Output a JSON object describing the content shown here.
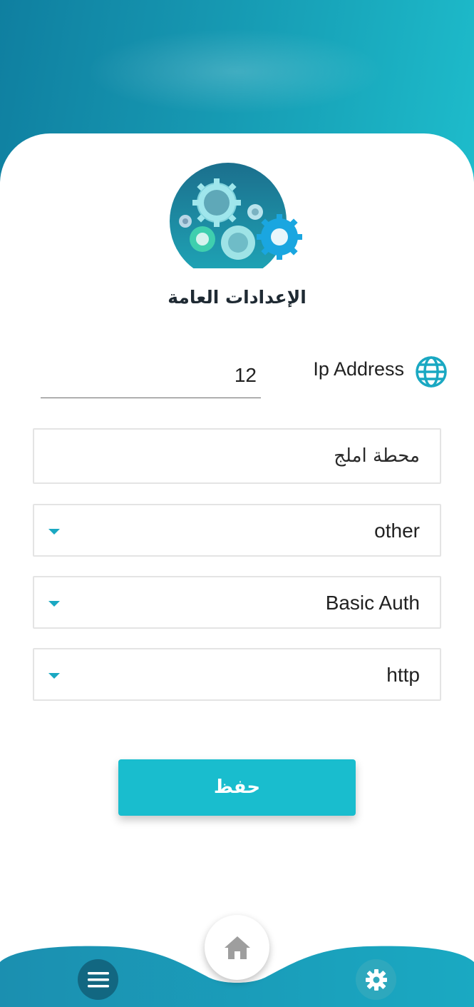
{
  "header": {
    "title": "الإعدادات العامة",
    "logo_icon": "gears-icon"
  },
  "ip_address": {
    "label": "Ip Address",
    "value": "12",
    "icon": "globe-icon"
  },
  "station": {
    "value": "محطة املج"
  },
  "selects": [
    {
      "value": "other"
    },
    {
      "value": "Basic Auth"
    },
    {
      "value": "http"
    }
  ],
  "save_button": {
    "label": "حفظ"
  },
  "bottom_nav": {
    "items": [
      "menu-icon",
      "home-icon",
      "settings-icon"
    ]
  },
  "colors": {
    "accent": "#19bdce",
    "header_dark": "#0f7fa0",
    "header_light": "#1ebdcc",
    "menu_button": "#126781"
  }
}
